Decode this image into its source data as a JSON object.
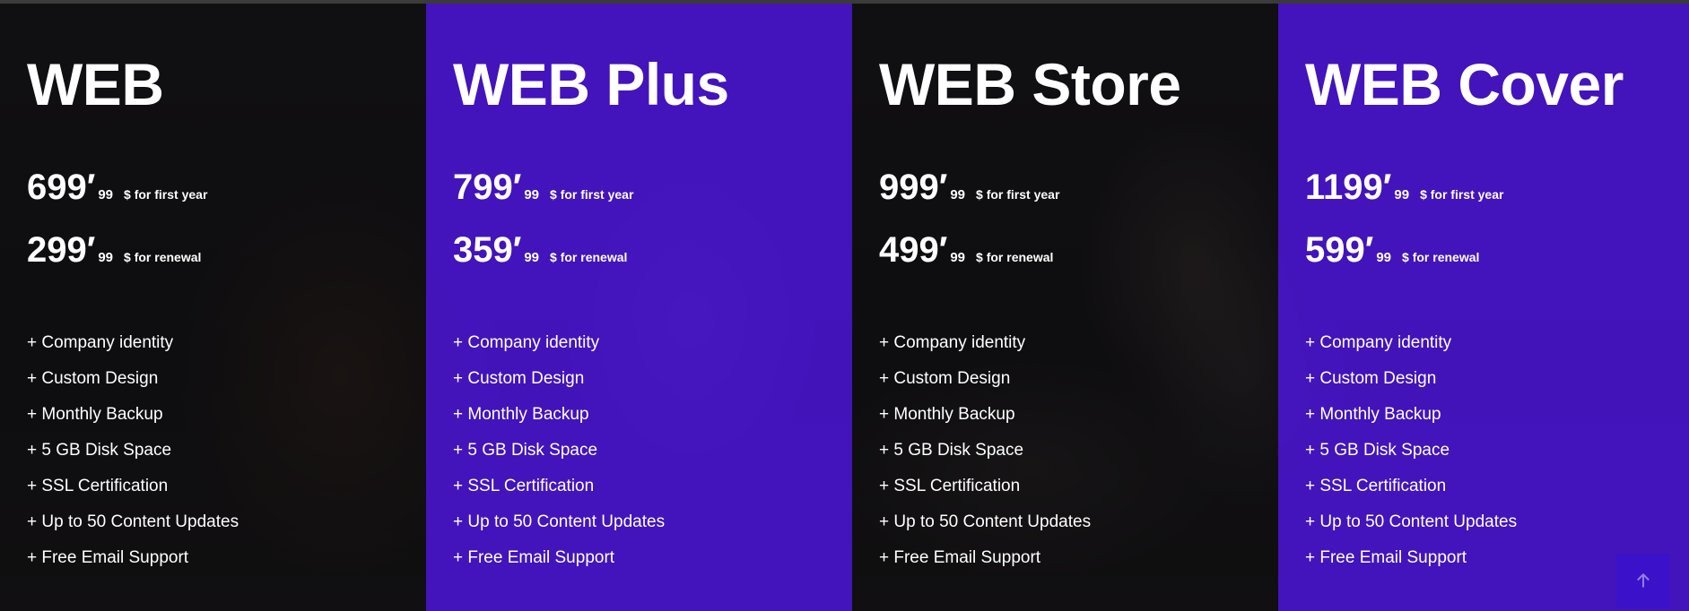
{
  "plans": [
    {
      "title": "WEB",
      "first_price": "699′",
      "first_cents": "99",
      "first_note": "$ for first year",
      "renew_price": "299′",
      "renew_cents": "99",
      "renew_note": "$ for renewal",
      "features": [
        "+ Company identity",
        "+ Custom Design",
        "+ Monthly Backup",
        "+ 5 GB Disk Space",
        "+ SSL Certification",
        "+ Up to 50 Content Updates",
        "+ Free Email Support"
      ]
    },
    {
      "title": "WEB Plus",
      "first_price": "799′",
      "first_cents": "99",
      "first_note": "$ for first year",
      "renew_price": "359′",
      "renew_cents": "99",
      "renew_note": "$ for renewal",
      "features": [
        "+ Company identity",
        "+ Custom Design",
        "+ Monthly Backup",
        "+ 5 GB Disk Space",
        "+ SSL Certification",
        "+ Up to 50 Content Updates",
        "+ Free Email Support"
      ]
    },
    {
      "title": "WEB Store",
      "first_price": "999′",
      "first_cents": "99",
      "first_note": "$ for first year",
      "renew_price": "499′",
      "renew_cents": "99",
      "renew_note": "$ for renewal",
      "features": [
        "+ Company identity",
        "+ Custom Design",
        "+ Monthly Backup",
        "+ 5 GB Disk Space",
        "+ SSL Certification",
        "+ Up to 50 Content Updates",
        "+ Free Email Support"
      ]
    },
    {
      "title": "WEB Cover",
      "first_price": "1199′",
      "first_cents": "99",
      "first_note": "$ for first year",
      "renew_price": "599′",
      "renew_cents": "99",
      "renew_note": "$ for renewal",
      "features": [
        "+ Company identity",
        "+ Custom Design",
        "+ Monthly Backup",
        "+ 5 GB Disk Space",
        "+ SSL Certification",
        "+ Up to 50 Content Updates",
        "+ Free Email Support"
      ]
    }
  ],
  "scroll_top": {
    "icon": "arrow-up-icon"
  },
  "colors": {
    "violet": "#4a14d6",
    "scroll_button": "#3b11c9",
    "text": "#ffffff"
  }
}
